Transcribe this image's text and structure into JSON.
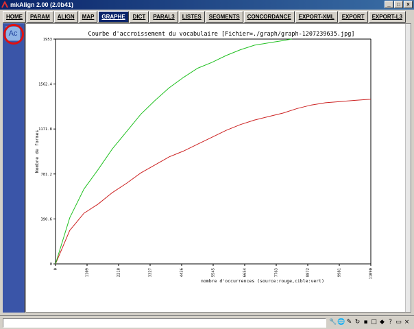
{
  "window": {
    "title": "mkAlign 2.00 (2.0b41)"
  },
  "tabs": [
    {
      "label": "HOME"
    },
    {
      "label": "PARAM"
    },
    {
      "label": "ALIGN"
    },
    {
      "label": "MAP"
    },
    {
      "label": "GRAPHE",
      "active": true
    },
    {
      "label": "DICT"
    },
    {
      "label": "PARAL3"
    },
    {
      "label": "LISTES"
    },
    {
      "label": "SEGMENTS"
    },
    {
      "label": "CONCORDANCE"
    },
    {
      "label": "EXPORT-XML"
    },
    {
      "label": "EXPORT"
    },
    {
      "label": "EXPORT-L3"
    }
  ],
  "sidebar": {
    "ac_label": "Ac",
    "highlight_color": "#e01010"
  },
  "chart_data": {
    "type": "line",
    "title": "Courbe d'accroissement du vocabulaire [Fichier=./graph/graph-1207239635.jpg]",
    "xlabel": "nombre d'occurrences (source:rouge,cible:vert)",
    "ylabel": "Nombre de formes",
    "x_ticks": [
      "0",
      "1109",
      "2218",
      "3327",
      "4436",
      "5545",
      "6654",
      "7763",
      "8872",
      "9981",
      "11090"
    ],
    "y_ticks": [
      "0",
      "390.6",
      "781.2",
      "1171.8",
      "1562.4",
      "1953"
    ],
    "xlim": [
      0,
      11090
    ],
    "ylim": [
      0,
      1953
    ],
    "grid": false,
    "series": [
      {
        "color": "#cc2020",
        "x": [
          0,
          500,
          1000,
          1500,
          2000,
          2500,
          3000,
          3500,
          4000,
          4500,
          5000,
          5500,
          6000,
          6500,
          7000,
          7500,
          8000,
          8500,
          9000,
          9500,
          10000,
          10500,
          11090
        ],
        "y": [
          0,
          290,
          440,
          520,
          620,
          700,
          790,
          860,
          930,
          980,
          1040,
          1100,
          1160,
          1210,
          1250,
          1280,
          1310,
          1350,
          1380,
          1400,
          1410,
          1420,
          1430
        ]
      },
      {
        "color": "#20c020",
        "x": [
          0,
          500,
          1000,
          1500,
          2000,
          2500,
          3000,
          3500,
          4000,
          4500,
          5000,
          5500,
          6000,
          6500,
          7000,
          7500,
          8000,
          8300
        ],
        "y": [
          0,
          400,
          650,
          820,
          1000,
          1150,
          1300,
          1420,
          1530,
          1620,
          1700,
          1750,
          1810,
          1860,
          1900,
          1920,
          1940,
          1953
        ]
      }
    ]
  },
  "statusbar": {
    "icons": [
      "tool-icon",
      "globe-icon",
      "pencil-icon",
      "refresh-icon",
      "disk-icon",
      "box-icon",
      "color-icon",
      "help-icon",
      "window-icon",
      "close-icon"
    ]
  }
}
